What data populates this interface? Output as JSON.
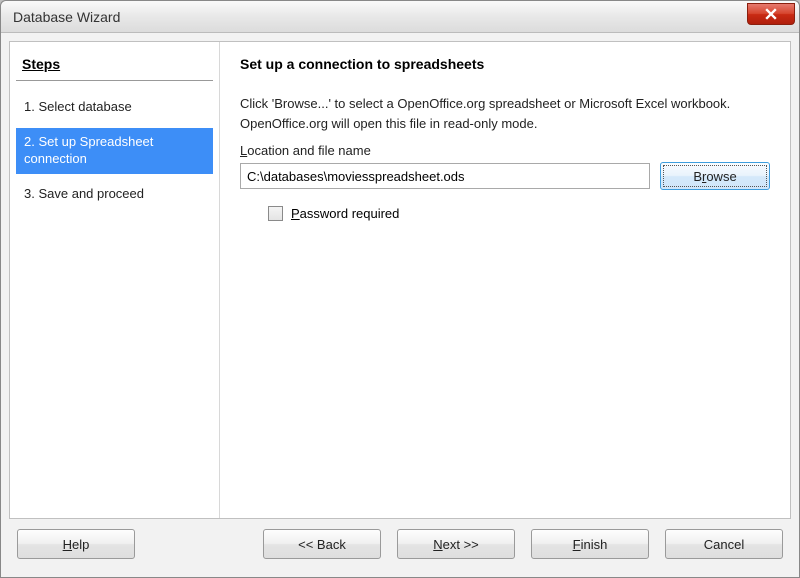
{
  "window": {
    "title": "Database Wizard"
  },
  "sidebar": {
    "header": "Steps",
    "steps": [
      {
        "num": "1.",
        "label": "Select database"
      },
      {
        "num": "2.",
        "label": "Set up Spreadsheet connection"
      },
      {
        "num": "3.",
        "label": "Save and proceed"
      }
    ],
    "active_index": 1
  },
  "panel": {
    "title": "Set up a connection to spreadsheets",
    "instr_line1": "Click 'Browse...' to select a OpenOffice.org spreadsheet or Microsoft Excel workbook.",
    "instr_line2": "OpenOffice.org will open this file in read-only mode.",
    "location_label_pre": "L",
    "location_label_post": "ocation and file name",
    "file_path": "C:\\databases\\moviesspreadsheet.ods",
    "browse_pre": "B",
    "browse_u": "r",
    "browse_post": "owse",
    "password_pre": "P",
    "password_post": "assword required",
    "password_checked": false
  },
  "buttons": {
    "help_pre": "H",
    "help_post": "elp",
    "back": "<< Back",
    "next_pre": "N",
    "next_post": "ext >>",
    "finish_pre": "F",
    "finish_post": "inish",
    "cancel": "Cancel"
  }
}
